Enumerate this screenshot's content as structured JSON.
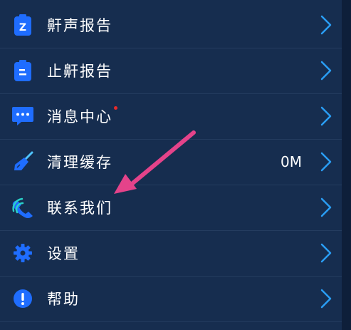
{
  "menu": {
    "items": [
      {
        "label": "鼾声报告",
        "icon": "snore-report-icon"
      },
      {
        "label": "止鼾报告",
        "icon": "stop-snore-report-icon"
      },
      {
        "label": "消息中心",
        "icon": "message-icon",
        "badge": "red-dot"
      },
      {
        "label": "清理缓存",
        "icon": "broom-icon",
        "value": "0M"
      },
      {
        "label": "联系我们",
        "icon": "phone-icon"
      },
      {
        "label": "设置",
        "icon": "gear-icon"
      },
      {
        "label": "帮助",
        "icon": "help-icon"
      }
    ]
  },
  "colors": {
    "background": "#162d4f",
    "icon_blue": "#1f6dff",
    "chevron": "#2a9df4",
    "arrow": "#e4438a",
    "badge": "#e62b2b"
  }
}
